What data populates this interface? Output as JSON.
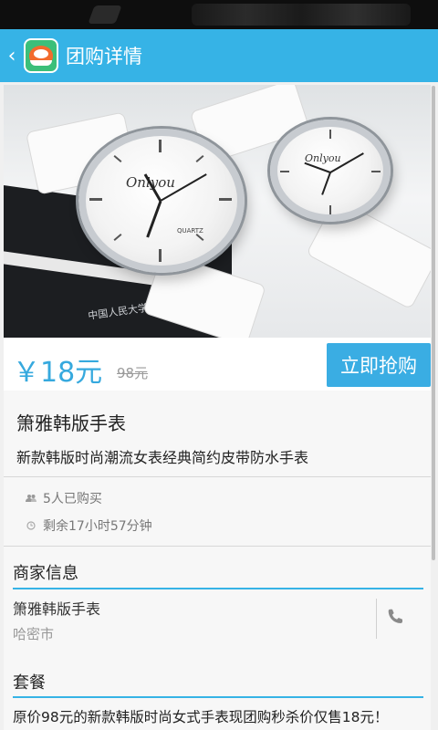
{
  "app_bar": {
    "title": "团购详情",
    "back_glyph": "‹",
    "accent": "#36b3e6"
  },
  "product_image": {
    "watch_brand": "Onlyou",
    "dial_text": "QUARTZ",
    "book_text": "中国人民大学出版社"
  },
  "price": {
    "current": "￥18元",
    "original": "98元",
    "buy_label": "立即抢购"
  },
  "product": {
    "name": "箫雅韩版手表",
    "description": "新款韩版时尚潮流女表经典简约皮带防水手表"
  },
  "stats": {
    "bought": "5人已购买",
    "remaining": "剩余17小时57分钟"
  },
  "merchant": {
    "section_title": "商家信息",
    "name": "箫雅韩版手表",
    "city": "哈密市"
  },
  "package": {
    "section_title": "套餐",
    "text": "原价98元的新款韩版时尚女式手表现团购秒杀价仅售18元！"
  },
  "icons": {
    "back": "chevron-left-icon",
    "logo": "app-logo-icon",
    "bought": "people-icon",
    "time": "clock-icon",
    "phone": "phone-icon"
  }
}
